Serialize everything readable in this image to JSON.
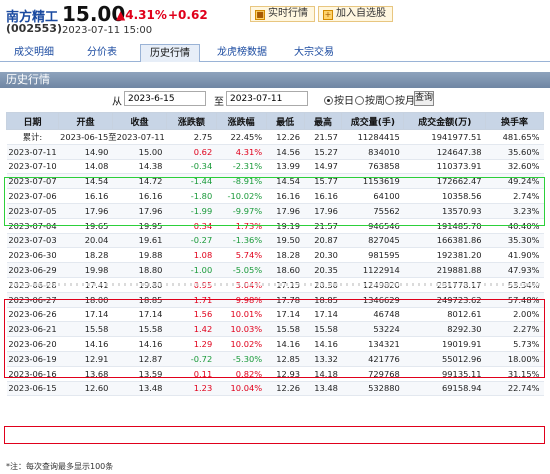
{
  "header": {
    "stock_name": "南方精工",
    "stock_code": "(002553)",
    "price": "15.00",
    "change_pct": "4.31%",
    "change_amt": "+0.62",
    "datetime": "2023-07-11 15:00",
    "btn_realtime": "实时行情",
    "btn_watchlist": "加入自选股",
    "up_color": "#e0001b",
    "down_color": "#1a9a3a"
  },
  "tabs": [
    {
      "label": "成交明细",
      "active": false
    },
    {
      "label": "分价表",
      "active": false
    },
    {
      "label": "历史行情",
      "active": true
    },
    {
      "label": "龙虎榜数据",
      "active": false
    },
    {
      "label": "大宗交易",
      "active": false
    }
  ],
  "section_title": "历史行情",
  "query": {
    "from_label": "从",
    "from_value": "2023-6-15",
    "to_label": "至",
    "to_value": "2023-07-11",
    "radio_day": "按日",
    "radio_week": "按周",
    "radio_month": "按月",
    "selected": "按日",
    "submit": "查询"
  },
  "table": {
    "headers": [
      "日期",
      "开盘",
      "收盘",
      "涨跌额",
      "涨跌幅",
      "最低",
      "最高",
      "成交量(手)",
      "成交金额(万)",
      "换手率"
    ],
    "rows": [
      {
        "date": "累计:",
        "open": "2023-06-15至2023-07-11",
        "close": "",
        "chg": "2.75",
        "pct": "22.45%",
        "low": "12.26",
        "high": "21.57",
        "vol": "11284415",
        "amt": "1941977.51",
        "turn": "481.65%",
        "dir": "neu"
      },
      {
        "date": "2023-07-11",
        "open": "14.90",
        "close": "15.00",
        "chg": "0.62",
        "pct": "4.31%",
        "low": "14.56",
        "high": "15.27",
        "vol": "834010",
        "amt": "124647.38",
        "turn": "35.60%",
        "dir": "up"
      },
      {
        "date": "2023-07-10",
        "open": "14.08",
        "close": "14.38",
        "chg": "-0.34",
        "pct": "-2.31%",
        "low": "13.99",
        "high": "14.97",
        "vol": "763858",
        "amt": "110373.91",
        "turn": "32.60%",
        "dir": "down"
      },
      {
        "date": "2023-07-07",
        "open": "14.54",
        "close": "14.72",
        "chg": "-1.44",
        "pct": "-8.91%",
        "low": "14.54",
        "high": "15.77",
        "vol": "1153619",
        "amt": "172662.47",
        "turn": "49.24%",
        "dir": "down"
      },
      {
        "date": "2023-07-06",
        "open": "16.16",
        "close": "16.16",
        "chg": "-1.80",
        "pct": "-10.02%",
        "low": "16.16",
        "high": "16.16",
        "vol": "64100",
        "amt": "10358.56",
        "turn": "2.74%",
        "dir": "down"
      },
      {
        "date": "2023-07-05",
        "open": "17.96",
        "close": "17.96",
        "chg": "-1.99",
        "pct": "-9.97%",
        "low": "17.96",
        "high": "17.96",
        "vol": "75562",
        "amt": "13570.93",
        "turn": "3.23%",
        "dir": "down"
      },
      {
        "date": "2023-07-04",
        "open": "19.65",
        "close": "19.95",
        "chg": "0.34",
        "pct": "1.73%",
        "low": "19.19",
        "high": "21.57",
        "vol": "946546",
        "amt": "191485.70",
        "turn": "40.40%",
        "dir": "up"
      },
      {
        "date": "2023-07-03",
        "open": "20.04",
        "close": "19.61",
        "chg": "-0.27",
        "pct": "-1.36%",
        "low": "19.50",
        "high": "20.87",
        "vol": "827045",
        "amt": "166381.86",
        "turn": "35.30%",
        "dir": "down"
      },
      {
        "date": "2023-06-30",
        "open": "18.28",
        "close": "19.88",
        "chg": "1.08",
        "pct": "5.74%",
        "low": "18.28",
        "high": "20.30",
        "vol": "981595",
        "amt": "192381.20",
        "turn": "41.90%",
        "dir": "up"
      },
      {
        "date": "2023-06-29",
        "open": "19.98",
        "close": "18.80",
        "chg": "-1.00",
        "pct": "-5.05%",
        "low": "18.60",
        "high": "20.35",
        "vol": "1122914",
        "amt": "219881.88",
        "turn": "47.93%",
        "dir": "down"
      },
      {
        "date": "2023-06-28",
        "open": "17.41",
        "close": "19.80",
        "chg": "0.95",
        "pct": "5.04%",
        "low": "17.15",
        "high": "20.30",
        "vol": "1249820",
        "amt": "231778.17",
        "turn": "53.34%",
        "dir": "up"
      },
      {
        "date": "2023-06-27",
        "open": "18.00",
        "close": "18.85",
        "chg": "1.71",
        "pct": "9.98%",
        "low": "17.78",
        "high": "18.85",
        "vol": "1346629",
        "amt": "249723.62",
        "turn": "57.48%",
        "dir": "up"
      },
      {
        "date": "2023-06-26",
        "open": "17.14",
        "close": "17.14",
        "chg": "1.56",
        "pct": "10.01%",
        "low": "17.14",
        "high": "17.14",
        "vol": "46748",
        "amt": "8012.61",
        "turn": "2.00%",
        "dir": "up"
      },
      {
        "date": "2023-06-21",
        "open": "15.58",
        "close": "15.58",
        "chg": "1.42",
        "pct": "10.03%",
        "low": "15.58",
        "high": "15.58",
        "vol": "53224",
        "amt": "8292.30",
        "turn": "2.27%",
        "dir": "up"
      },
      {
        "date": "2023-06-20",
        "open": "14.16",
        "close": "14.16",
        "chg": "1.29",
        "pct": "10.02%",
        "low": "14.16",
        "high": "14.16",
        "vol": "134321",
        "amt": "19019.91",
        "turn": "5.73%",
        "dir": "up"
      },
      {
        "date": "2023-06-19",
        "open": "12.91",
        "close": "12.87",
        "chg": "-0.72",
        "pct": "-5.30%",
        "low": "12.85",
        "high": "13.32",
        "vol": "421776",
        "amt": "55012.96",
        "turn": "18.00%",
        "dir": "down"
      },
      {
        "date": "2023-06-16",
        "open": "13.68",
        "close": "13.59",
        "chg": "0.11",
        "pct": "0.82%",
        "low": "12.93",
        "high": "14.18",
        "vol": "729768",
        "amt": "99135.11",
        "turn": "31.15%",
        "dir": "up"
      },
      {
        "date": "2023-06-15",
        "open": "12.60",
        "close": "13.48",
        "chg": "1.23",
        "pct": "10.04%",
        "low": "12.26",
        "high": "13.48",
        "vol": "532880",
        "amt": "69158.94",
        "turn": "22.74%",
        "dir": "up"
      }
    ]
  },
  "note": "*注：每次查询最多显示100条"
}
